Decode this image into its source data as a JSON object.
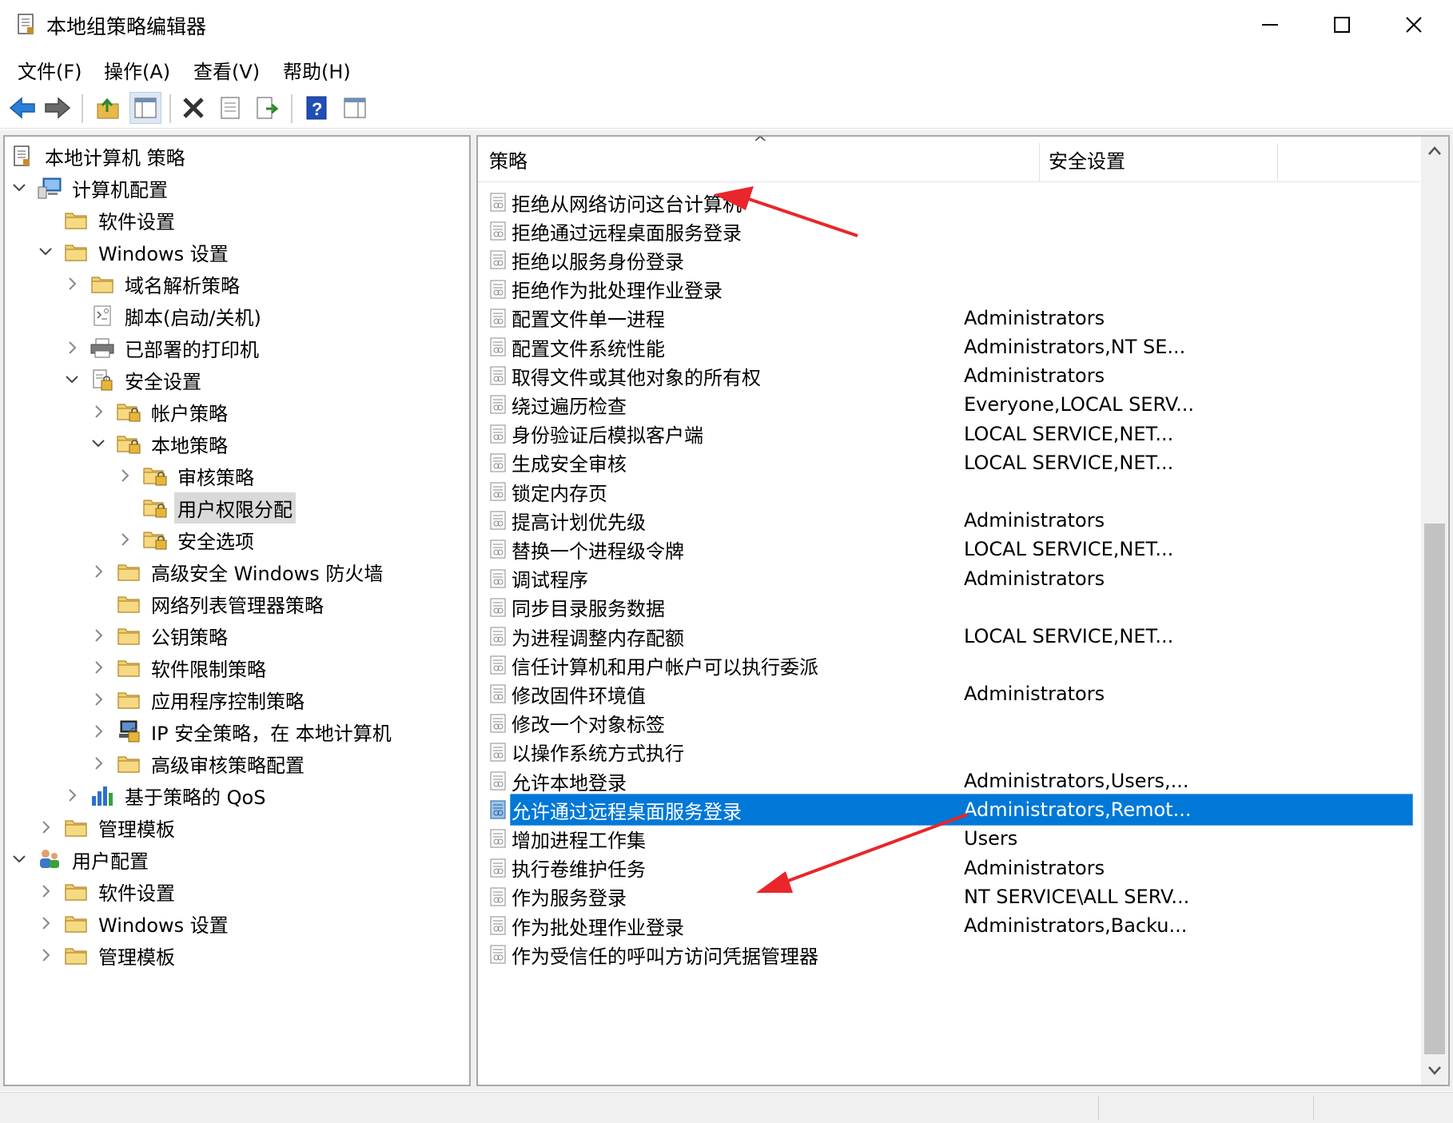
{
  "window": {
    "title": "本地组策略编辑器"
  },
  "menu": [
    "文件(F)",
    "操作(A)",
    "查看(V)",
    "帮助(H)"
  ],
  "toolbar": [
    "back-icon",
    "forward-icon",
    "up-folder-icon",
    "show-hide-tree-icon",
    "delete-icon",
    "properties-icon",
    "export-list-icon",
    "help-icon",
    "show-pane-icon"
  ],
  "tree": [
    {
      "label": "本地计算机 策略",
      "level": 0,
      "expander": "none",
      "icon": "policy-doc-icon"
    },
    {
      "label": "计算机配置",
      "level": 0,
      "expander": "expanded",
      "icon": "computer-icon"
    },
    {
      "label": "软件设置",
      "level": 1,
      "expander": "none",
      "icon": "folder-icon"
    },
    {
      "label": "Windows 设置",
      "level": 1,
      "expander": "expanded",
      "icon": "folder-icon"
    },
    {
      "label": "域名解析策略",
      "level": 2,
      "expander": "collapsed",
      "icon": "folder-icon"
    },
    {
      "label": "脚本(启动/关机)",
      "level": 2,
      "expander": "none",
      "icon": "script-icon"
    },
    {
      "label": "已部署的打印机",
      "level": 2,
      "expander": "collapsed",
      "icon": "printer-icon"
    },
    {
      "label": "安全设置",
      "level": 2,
      "expander": "expanded",
      "icon": "security-icon"
    },
    {
      "label": "帐户策略",
      "level": 3,
      "expander": "collapsed",
      "icon": "secure-folder-icon"
    },
    {
      "label": "本地策略",
      "level": 3,
      "expander": "expanded",
      "icon": "secure-folder-icon"
    },
    {
      "label": "审核策略",
      "level": 4,
      "expander": "collapsed",
      "icon": "secure-folder-icon"
    },
    {
      "label": "用户权限分配",
      "level": 4,
      "expander": "none",
      "icon": "secure-folder-icon",
      "selected": true
    },
    {
      "label": "安全选项",
      "level": 4,
      "expander": "collapsed",
      "icon": "secure-folder-icon"
    },
    {
      "label": "高级安全 Windows 防火墙",
      "level": 3,
      "expander": "collapsed",
      "icon": "folder-icon"
    },
    {
      "label": "网络列表管理器策略",
      "level": 3,
      "expander": "none",
      "icon": "folder-icon"
    },
    {
      "label": "公钥策略",
      "level": 3,
      "expander": "collapsed",
      "icon": "folder-icon"
    },
    {
      "label": "软件限制策略",
      "level": 3,
      "expander": "collapsed",
      "icon": "folder-icon"
    },
    {
      "label": "应用程序控制策略",
      "level": 3,
      "expander": "collapsed",
      "icon": "folder-icon"
    },
    {
      "label": "IP 安全策略，在 本地计算机",
      "level": 3,
      "expander": "collapsed",
      "icon": "ip-security-icon"
    },
    {
      "label": "高级审核策略配置",
      "level": 3,
      "expander": "collapsed",
      "icon": "folder-icon"
    },
    {
      "label": "基于策略的 QoS",
      "level": 2,
      "expander": "collapsed",
      "icon": "qos-chart-icon"
    },
    {
      "label": "管理模板",
      "level": 1,
      "expander": "collapsed",
      "icon": "folder-icon"
    },
    {
      "label": "用户配置",
      "level": 0,
      "expander": "expanded",
      "icon": "users-icon"
    },
    {
      "label": "软件设置",
      "level": 1,
      "expander": "collapsed",
      "icon": "folder-icon"
    },
    {
      "label": "Windows 设置",
      "level": 1,
      "expander": "collapsed",
      "icon": "folder-icon"
    },
    {
      "label": "管理模板",
      "level": 1,
      "expander": "collapsed",
      "icon": "folder-icon"
    }
  ],
  "list": {
    "columns": [
      "策略",
      "安全设置"
    ],
    "sort_indicator": "^",
    "rows": [
      {
        "name": "拒绝从网络访问这台计算机",
        "value": ""
      },
      {
        "name": "拒绝通过远程桌面服务登录",
        "value": ""
      },
      {
        "name": "拒绝以服务身份登录",
        "value": ""
      },
      {
        "name": "拒绝作为批处理作业登录",
        "value": ""
      },
      {
        "name": "配置文件单一进程",
        "value": "Administrators"
      },
      {
        "name": "配置文件系统性能",
        "value": "Administrators,NT SE..."
      },
      {
        "name": "取得文件或其他对象的所有权",
        "value": "Administrators"
      },
      {
        "name": "绕过遍历检查",
        "value": "Everyone,LOCAL SERV..."
      },
      {
        "name": "身份验证后模拟客户端",
        "value": "LOCAL SERVICE,NET..."
      },
      {
        "name": "生成安全审核",
        "value": "LOCAL SERVICE,NET..."
      },
      {
        "name": "锁定内存页",
        "value": ""
      },
      {
        "name": "提高计划优先级",
        "value": "Administrators"
      },
      {
        "name": "替换一个进程级令牌",
        "value": "LOCAL SERVICE,NET..."
      },
      {
        "name": "调试程序",
        "value": "Administrators"
      },
      {
        "name": "同步目录服务数据",
        "value": ""
      },
      {
        "name": "为进程调整内存配额",
        "value": "LOCAL SERVICE,NET..."
      },
      {
        "name": "信任计算机和用户帐户可以执行委派",
        "value": ""
      },
      {
        "name": "修改固件环境值",
        "value": "Administrators"
      },
      {
        "name": "修改一个对象标签",
        "value": ""
      },
      {
        "name": "以操作系统方式执行",
        "value": ""
      },
      {
        "name": "允许本地登录",
        "value": "Administrators,Users,..."
      },
      {
        "name": "允许通过远程桌面服务登录",
        "value": "Administrators,Remot...",
        "selected": true
      },
      {
        "name": "增加进程工作集",
        "value": "Users"
      },
      {
        "name": "执行卷维护任务",
        "value": "Administrators"
      },
      {
        "name": "作为服务登录",
        "value": "NT SERVICE\\ALL SERV..."
      },
      {
        "name": "作为批处理作业登录",
        "value": "Administrators,Backu..."
      },
      {
        "name": "作为受信任的呼叫方访问凭据管理器",
        "value": ""
      }
    ]
  },
  "colors": {
    "selection": "#0078d7",
    "annotation_arrow": "#e8262b"
  }
}
